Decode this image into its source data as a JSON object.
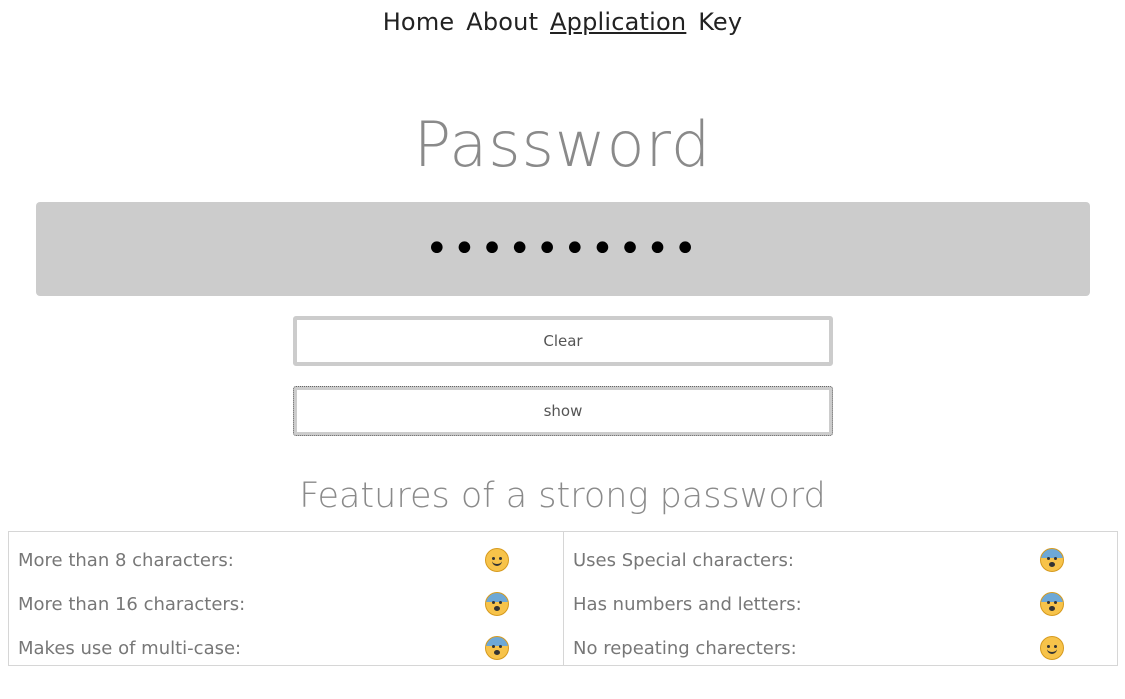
{
  "nav": {
    "items": [
      {
        "label": "Home"
      },
      {
        "label": "About"
      },
      {
        "label": "Application"
      },
      {
        "label": "Key"
      }
    ]
  },
  "title": "Password",
  "password_field": {
    "value": "••••••••••"
  },
  "buttons": {
    "clear_label": "Clear",
    "show_label": "show"
  },
  "features": {
    "title": "Features of a strong password",
    "left": [
      {
        "label": "More than 8 characters:",
        "status": "smile-icon"
      },
      {
        "label": "More than 16 characters:",
        "status": "fearful-icon"
      },
      {
        "label": "Makes use of multi-case:",
        "status": "fearful-icon"
      }
    ],
    "right": [
      {
        "label": "Uses Special characters:",
        "status": "fearful-icon"
      },
      {
        "label": "Has numbers and letters:",
        "status": "fearful-icon"
      },
      {
        "label": "No repeating charecters:",
        "status": "smile-icon"
      }
    ]
  }
}
